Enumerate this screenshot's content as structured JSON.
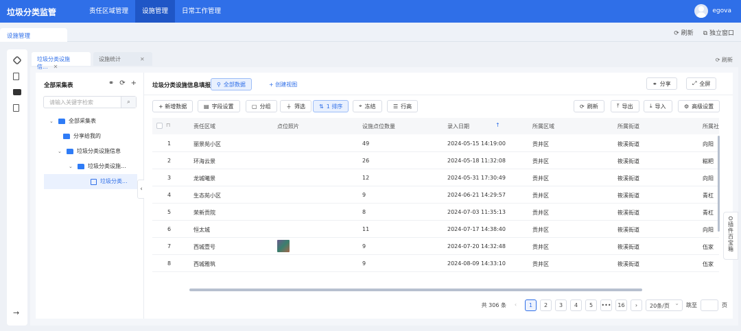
{
  "app": {
    "title": "垃圾分类监管",
    "user": "egova"
  },
  "topnav": [
    "责任区域管理",
    "设施管理",
    "日常工作管理"
  ],
  "pagetab": "设施管理",
  "window_actions": {
    "refresh": "刷新",
    "standalone": "独立窗口"
  },
  "subtabs": [
    {
      "label": "垃圾分类设施信..."
    },
    {
      "label": "设施统计"
    }
  ],
  "subtab_refresh": "刷新",
  "tree": {
    "title": "全部采集表",
    "search_placeholder": "请输入关键字检索",
    "nodes": [
      {
        "label": "全部采集表"
      },
      {
        "label": "分享给我的"
      },
      {
        "label": "垃圾分类设施信息"
      },
      {
        "label": "垃圾分类设施..."
      },
      {
        "label": "垃圾分类..."
      }
    ]
  },
  "panel": {
    "title": "垃圾分类设施信息填报",
    "all_data": "全部数据",
    "create_view": "+ 创建视图",
    "share": "分享",
    "fullscreen": "全屏"
  },
  "toolbar": {
    "add": "+ 新增数据",
    "fields": "字段设置",
    "group": "分组",
    "filter": "筛选",
    "sort": "1 排序",
    "freeze": "冻结",
    "rowheight": "行高",
    "refresh": "刷新",
    "export": "导出",
    "import": "导入",
    "advanced": "高级设置"
  },
  "table": {
    "columns": [
      "责任区域",
      "点位照片",
      "设施点位数量",
      "录入日期",
      "所属区域",
      "所属街道",
      "所属社"
    ],
    "rows": [
      [
        "1",
        "丽景苑小区",
        "",
        "49",
        "2024-05-15 14:19:00",
        "贡井区",
        "筱溪街道",
        "向阳"
      ],
      [
        "2",
        "环海云景",
        "",
        "26",
        "2024-05-18 11:32:08",
        "贡井区",
        "筱溪街道",
        "糍粑"
      ],
      [
        "3",
        "龙城曦景",
        "",
        "12",
        "2024-05-31 17:30:49",
        "贡井区",
        "筱溪街道",
        "向阳"
      ],
      [
        "4",
        "生态苑小区",
        "",
        "9",
        "2024-06-21 14:29:57",
        "贡井区",
        "筱溪街道",
        "青杠"
      ],
      [
        "5",
        "荣新贡院",
        "",
        "8",
        "2024-07-03 11:35:13",
        "贡井区",
        "筱溪街道",
        "青杠"
      ],
      [
        "6",
        "恒太城",
        "",
        "11",
        "2024-07-17 14:38:40",
        "贡井区",
        "筱溪街道",
        "向阳"
      ],
      [
        "7",
        "西城壹号",
        "photo",
        "9",
        "2024-07-20 14:32:48",
        "贡井区",
        "筱溪街道",
        "伍家"
      ],
      [
        "8",
        "西城雅筑",
        "",
        "9",
        "2024-08-09 14:33:10",
        "贡井区",
        "筱溪街道",
        "伍家"
      ]
    ]
  },
  "pager": {
    "total": "共 306 条",
    "pages": [
      "1",
      "2",
      "3",
      "4",
      "5",
      "•••",
      "16"
    ],
    "page_size": "20条/页",
    "goto": "跳至",
    "page_unit": "页"
  },
  "toolbox": "插件百宝箱"
}
